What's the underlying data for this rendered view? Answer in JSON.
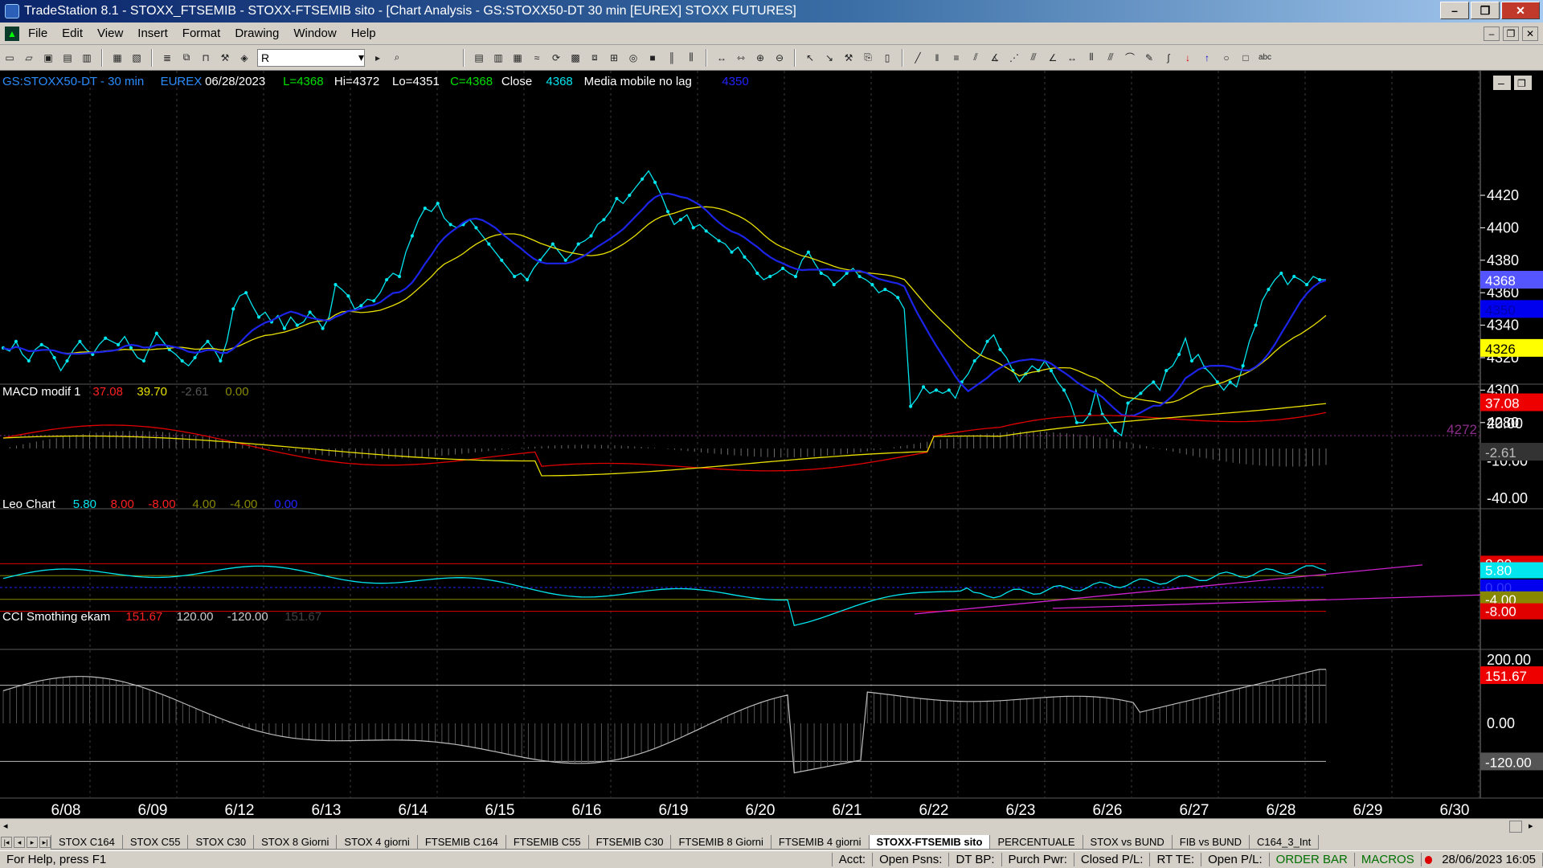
{
  "window": {
    "title": "TradeStation 8.1 - STOXX_FTSEMIB - STOXX-FTSEMIB sito - [Chart Analysis - GS:STOXX50-DT  30 min  [EUREX] STOXX FUTURES]",
    "minimize": "–",
    "restore": "❐",
    "close": "✕"
  },
  "menu": [
    "File",
    "Edit",
    "View",
    "Insert",
    "Format",
    "Drawing",
    "Window",
    "Help"
  ],
  "toolbar": {
    "symbol_value": "R"
  },
  "chart": {
    "colors": {
      "bg": "#000000",
      "price": "#00e5ee",
      "blue_ma": "#1c24e8",
      "yellow_ma": "#e8e000",
      "red": "#e00000",
      "magenta": "#cc22cc",
      "grid": "#3a3a3a",
      "axis": "#ffffff",
      "purple": "#8b2d8b"
    },
    "header": {
      "symbol": "GS:STOXX50-DT - 30 min",
      "exchange": "EUREX",
      "date": "06/28/2023",
      "low": "L=4368",
      "high": "Hi=4372",
      "lo": "Lo=4351",
      "close": "C=4368",
      "close_label": "Close",
      "close_val": "4368",
      "ma_name": "Media mobile no lag",
      "ma_val": "4350"
    },
    "price_axis": [
      "4420",
      "4400",
      "4380",
      "4360",
      "4340",
      "4320",
      "4300",
      "4280"
    ],
    "price_tags": {
      "last": "4368",
      "ma": "4350",
      "other": "4326",
      "level": "4272"
    },
    "macd": {
      "name": "MACD modif 1",
      "v1": "37.08",
      "v2": "39.70",
      "v3": "-2.61",
      "v4": "0.00",
      "axis": [
        "20.00",
        "-10.00",
        "-40.00"
      ],
      "tags": {
        "red": "37.08",
        "hist": "-2.61"
      }
    },
    "leo": {
      "name": "Leo Chart",
      "v1": "5.80",
      "v2": "8.00",
      "v3": "-8.00",
      "v4": "4.00",
      "v5": "-4.00",
      "v6": "0.00",
      "tags": {
        "top": "8.00",
        "val": "5.80",
        "four": "4.00",
        "zero": "0.00",
        "mfour": "-4.00",
        "meight": "-8.00"
      }
    },
    "cci": {
      "name": "CCI Smothing ekam",
      "v1": "151.67",
      "v2": "120.00",
      "v3": "-120.00",
      "v4": "151.67",
      "axis": [
        "200.00",
        "0.00"
      ],
      "tags": {
        "val": "151.67",
        "plus": "120.00",
        "minus": "-120.00"
      }
    },
    "dates": [
      "6/08",
      "6/09",
      "6/12",
      "6/13",
      "6/14",
      "6/15",
      "6/16",
      "6/19",
      "6/20",
      "6/21",
      "6/22",
      "6/23",
      "6/26",
      "6/27",
      "6/28",
      "6/29",
      "6/30"
    ]
  },
  "tabs": [
    "STOX C164",
    "STOX C55",
    "STOX  C30",
    "STOX  8 Giorni",
    "STOX 4 giorni",
    "FTSEMIB C164",
    "FTSEMIB C55",
    "FTSEMIB C30",
    "FTSEMIB  8 Giorni",
    "FTSEMIB  4 giorni",
    "STOXX-FTSEMIB sito",
    "PERCENTUALE",
    "STOX vs BUND",
    "FIB vs BUND",
    "C164_3_Int"
  ],
  "active_tab": "STOXX-FTSEMIB sito",
  "status": {
    "help": "For Help, press F1",
    "acct": "Acct:",
    "open_psns": "Open Psns:",
    "dt_bp": "DT BP:",
    "purch_pwr": "Purch Pwr:",
    "closed_pl": "Closed P/L:",
    "rt_te": "RT TE:",
    "open_pl": "Open P/L:",
    "order_bar": "ORDER BAR",
    "macros": "MACROS",
    "datetime": "28/06/2023 16:05"
  }
}
